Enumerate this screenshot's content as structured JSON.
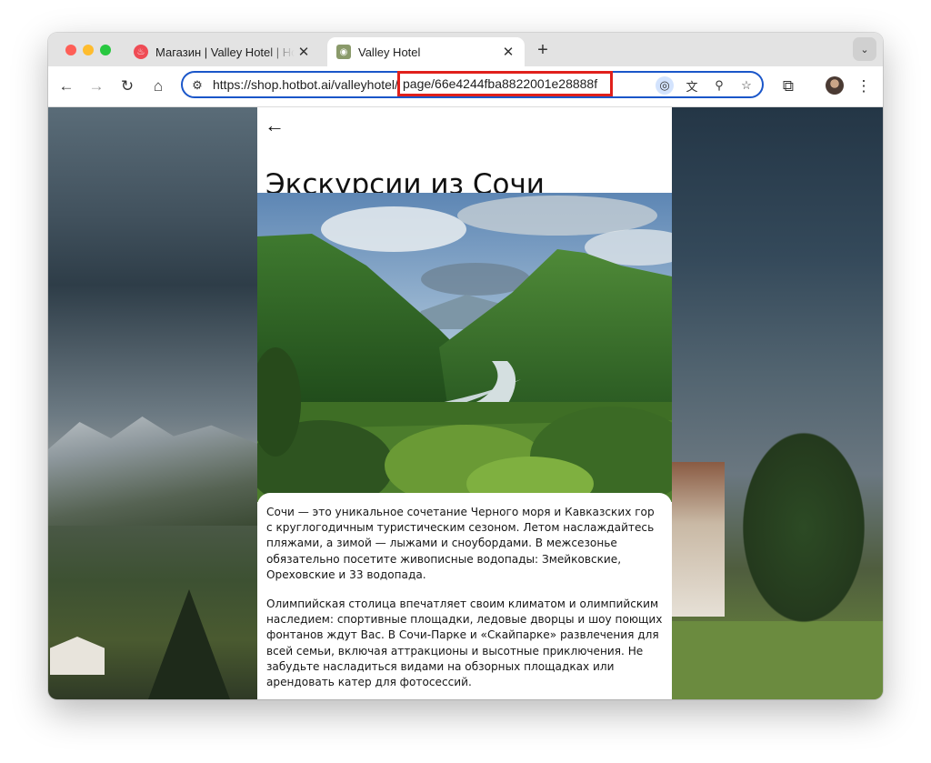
{
  "browser": {
    "tabs": [
      {
        "title": "Магазин | Valley Hotel | Hotbot",
        "active": false
      },
      {
        "title": "Valley Hotel",
        "active": true
      }
    ],
    "url_visible": "https://shop.hotbot.ai/valleyhotel/",
    "url_highlighted": "page/66e4244fba8822001e28888f",
    "highlight_color": "#e0201b",
    "omnibox_border_color": "#1a56c9"
  },
  "page": {
    "heading": "Экскурсии из Сочи",
    "paragraphs": [
      "Сочи — это уникальное сочетание Черного моря и Кавказских гор с круглогодичным туристическим сезоном. Летом наслаждайтесь пляжами, а зимой — лыжами и сноубордами. В межсезонье обязательно посетите живописные водопады: Змейковские, Ореховские и 33 водопада.",
      "Олимпийская столица впечатляет своим климатом и олимпийским наследием: спортивные площадки, ледовые дворцы и шоу поющих фонтанов ждут Вас. В Сочи-Парке и «Скайпарке» развлечения для всей семьи, включая аттракционы и высотные приключения. Не забудьте насладиться видами на обзорных площадках или арендовать катер для фотосессий."
    ]
  },
  "icons": {
    "back": "arrow-left-icon",
    "forward": "arrow-right-icon",
    "reload": "reload-icon",
    "home": "home-icon"
  }
}
